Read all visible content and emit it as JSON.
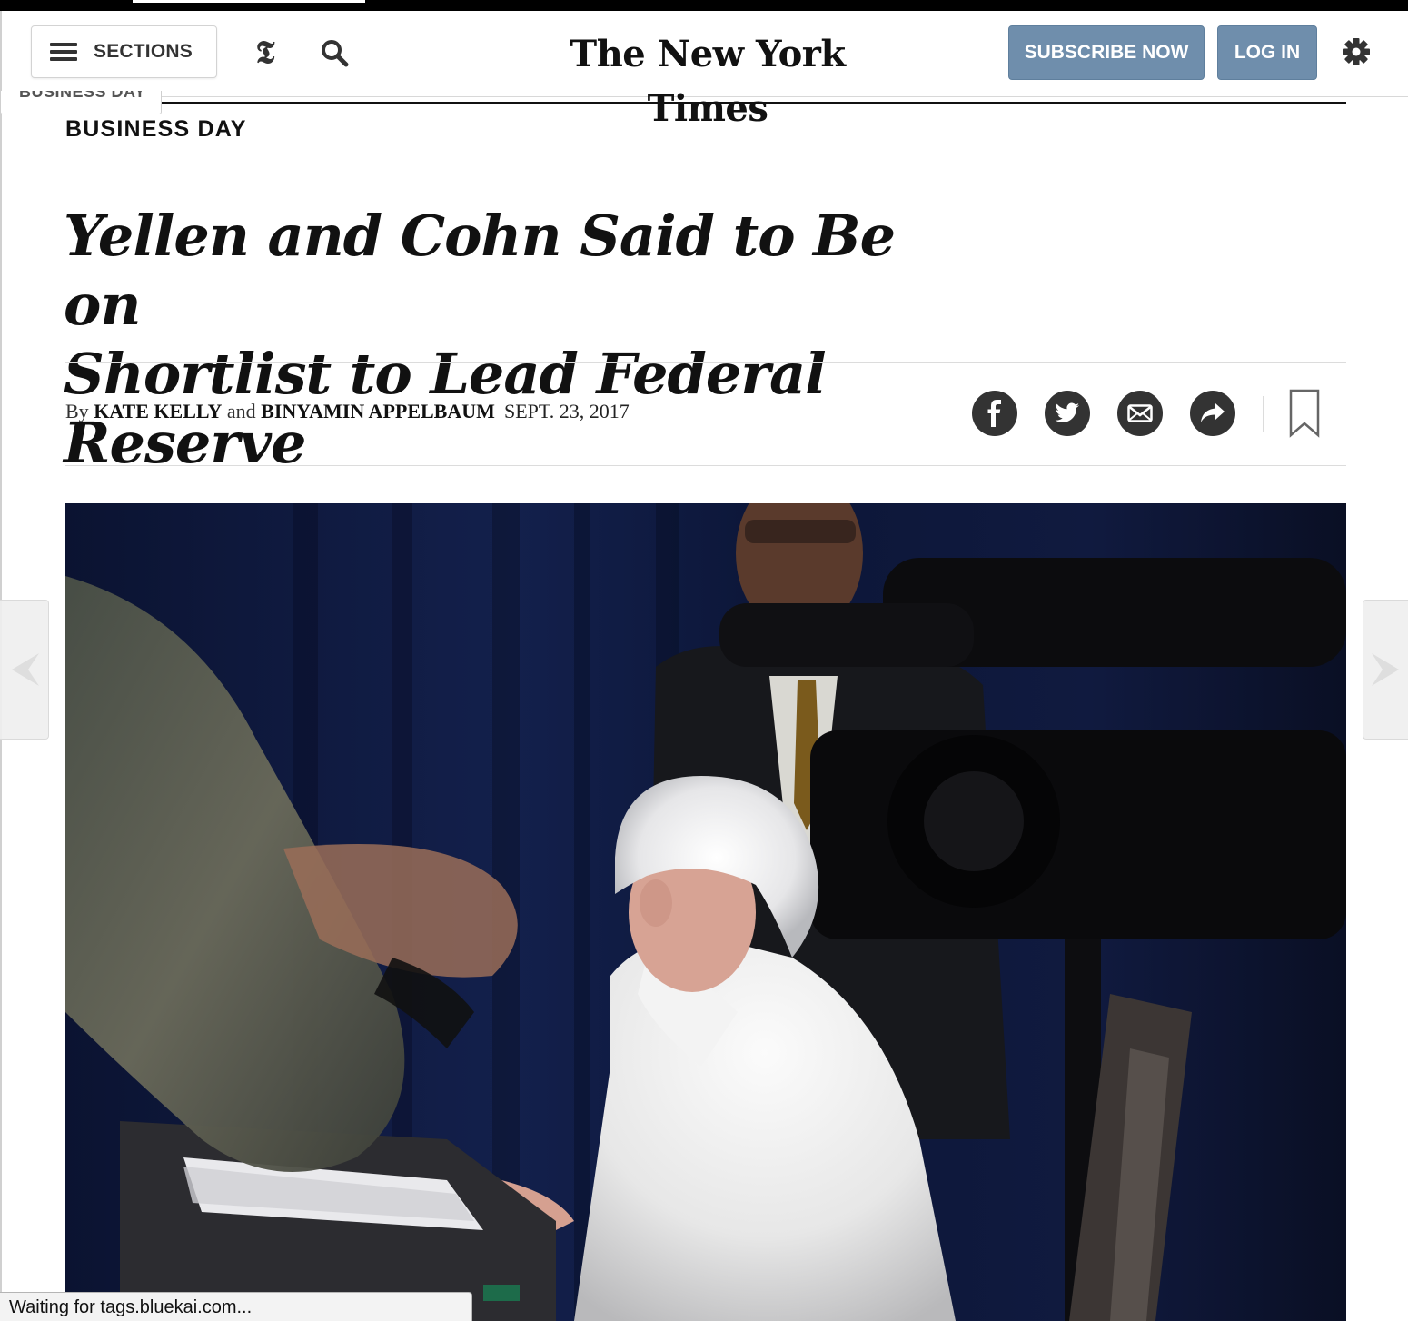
{
  "masthead": {
    "sections_label": "SECTIONS",
    "logo_glyph": "𝕿",
    "wordmark": "The New York Times",
    "subscribe_label": "SUBSCRIBE NOW",
    "login_label": "LOG IN",
    "button_color": "#6f8eac"
  },
  "ribbon": {
    "tab_label": "BUSINESS DAY"
  },
  "article": {
    "kicker": "BUSINESS DAY",
    "headline_line1": "Yellen and Cohn Said to Be on",
    "headline_line2": "Shortlist to Lead Federal Reserve",
    "byline_prefix": "By",
    "author1": "KATE KELLY",
    "byline_and": "and",
    "author2": "BINYAMIN APPELBAUM",
    "date": "SEPT. 23, 2017"
  },
  "share_tools": {
    "icons": [
      "facebook-icon",
      "twitter-icon",
      "email-icon",
      "more-share-icon",
      "bookmark-icon"
    ]
  },
  "carousel": {
    "prev_glyph": "◀",
    "next_glyph": "▶"
  },
  "browser": {
    "status_text": "Waiting for tags.bluekai.com..."
  }
}
